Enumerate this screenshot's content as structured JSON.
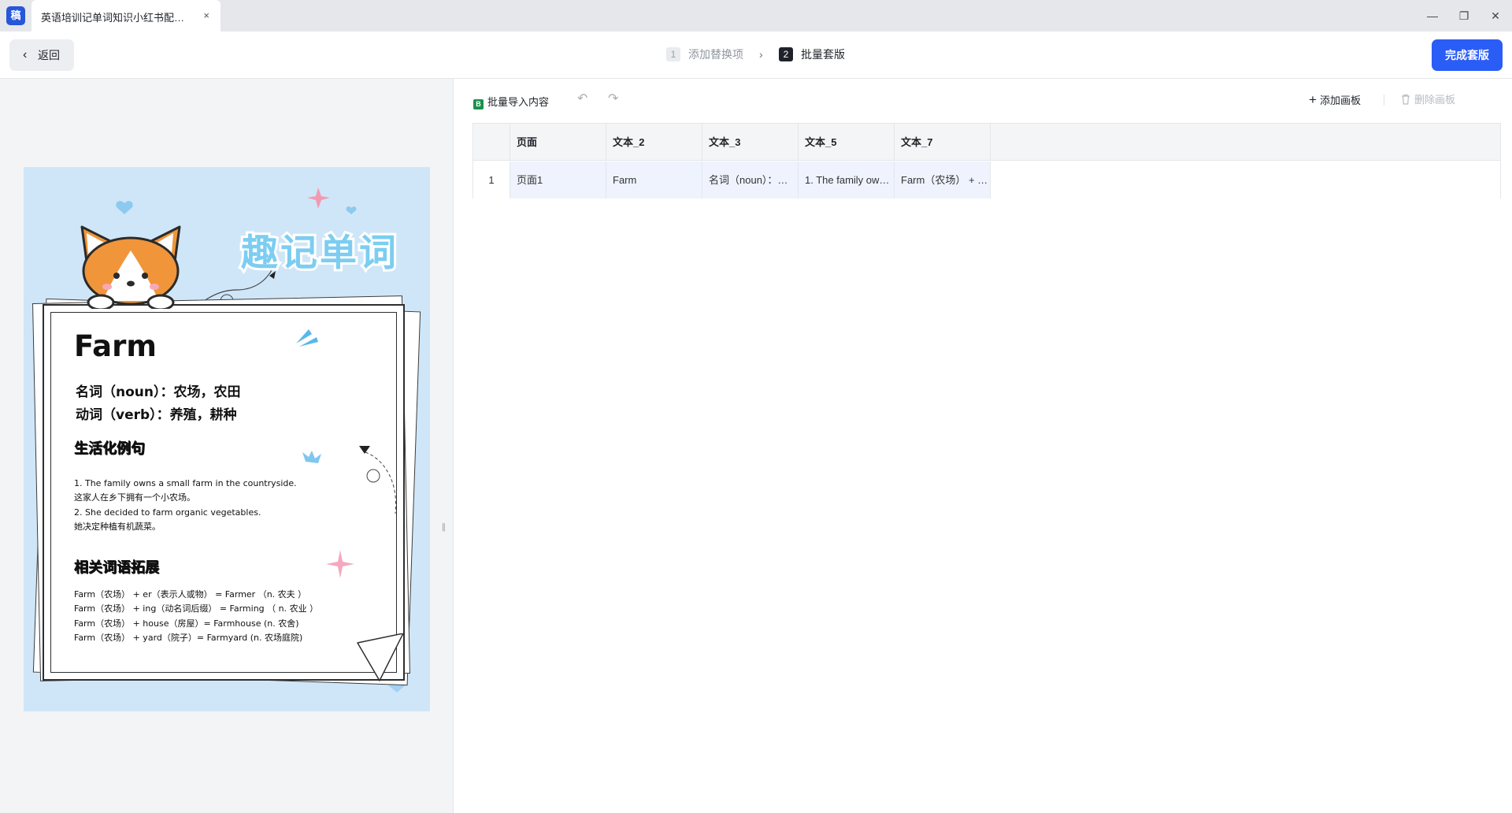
{
  "window": {
    "app_logo_text": "稿",
    "tab_title": "英语培训记单词知识小红书配图_...",
    "close_glyph": "×",
    "minimize_glyph": "—",
    "restore_glyph": "❐",
    "window_close_glyph": "✕"
  },
  "topbar": {
    "back_label": "返回",
    "steps": [
      {
        "num": "1",
        "label": "添加替换项",
        "state": "inactive"
      },
      {
        "num": "2",
        "label": "批量套版",
        "state": "active"
      }
    ],
    "finish_label": "完成套版"
  },
  "poster": {
    "title": "趣记单词",
    "word": "Farm",
    "noun_line": "名词（noun）：农场，农田",
    "verb_line": "动词（verb）：养殖，耕种",
    "section1_heading": "生活化例句",
    "sentences": [
      "1. The family owns a small farm in the countryside.",
      "这家人在乡下拥有一个小农场。",
      "2. She decided to farm organic vegetables.",
      "她决定种植有机蔬菜。"
    ],
    "section2_heading": "相关词语拓展",
    "expansions": [
      "Farm（农场） + er（表示人或物） = Farmer （n. 农夫 ）",
      "Farm（农场） + ing（动名词后缀） = Farming （ n. 农业 ）",
      "Farm（农场） + house（房屋）= Farmhouse (n. 农舍)",
      "Farm（农场） + yard（院子）= Farmyard (n. 农场庭院)"
    ],
    "colors": {
      "background": "#cfe6f8",
      "title": "#7ccdf1",
      "corgi": "#f0953a"
    }
  },
  "toolbar": {
    "import_label": "批量导入内容",
    "undo_icon": "undo-icon",
    "redo_icon": "redo-icon",
    "add_board_label": "添加画板",
    "delete_board_label": "删除画板"
  },
  "table": {
    "headers": [
      "",
      "页面",
      "文本_2",
      "文本_3",
      "文本_5",
      "文本_7"
    ],
    "rows": [
      [
        "1",
        "页面1",
        "Farm",
        "名词（noun）：农场，农田",
        "1. The family owns a small farm in the countryside.",
        "Farm（农场） + er（表示人或物） = Farmer"
      ]
    ]
  },
  "accent_color": "#2a5cf6"
}
